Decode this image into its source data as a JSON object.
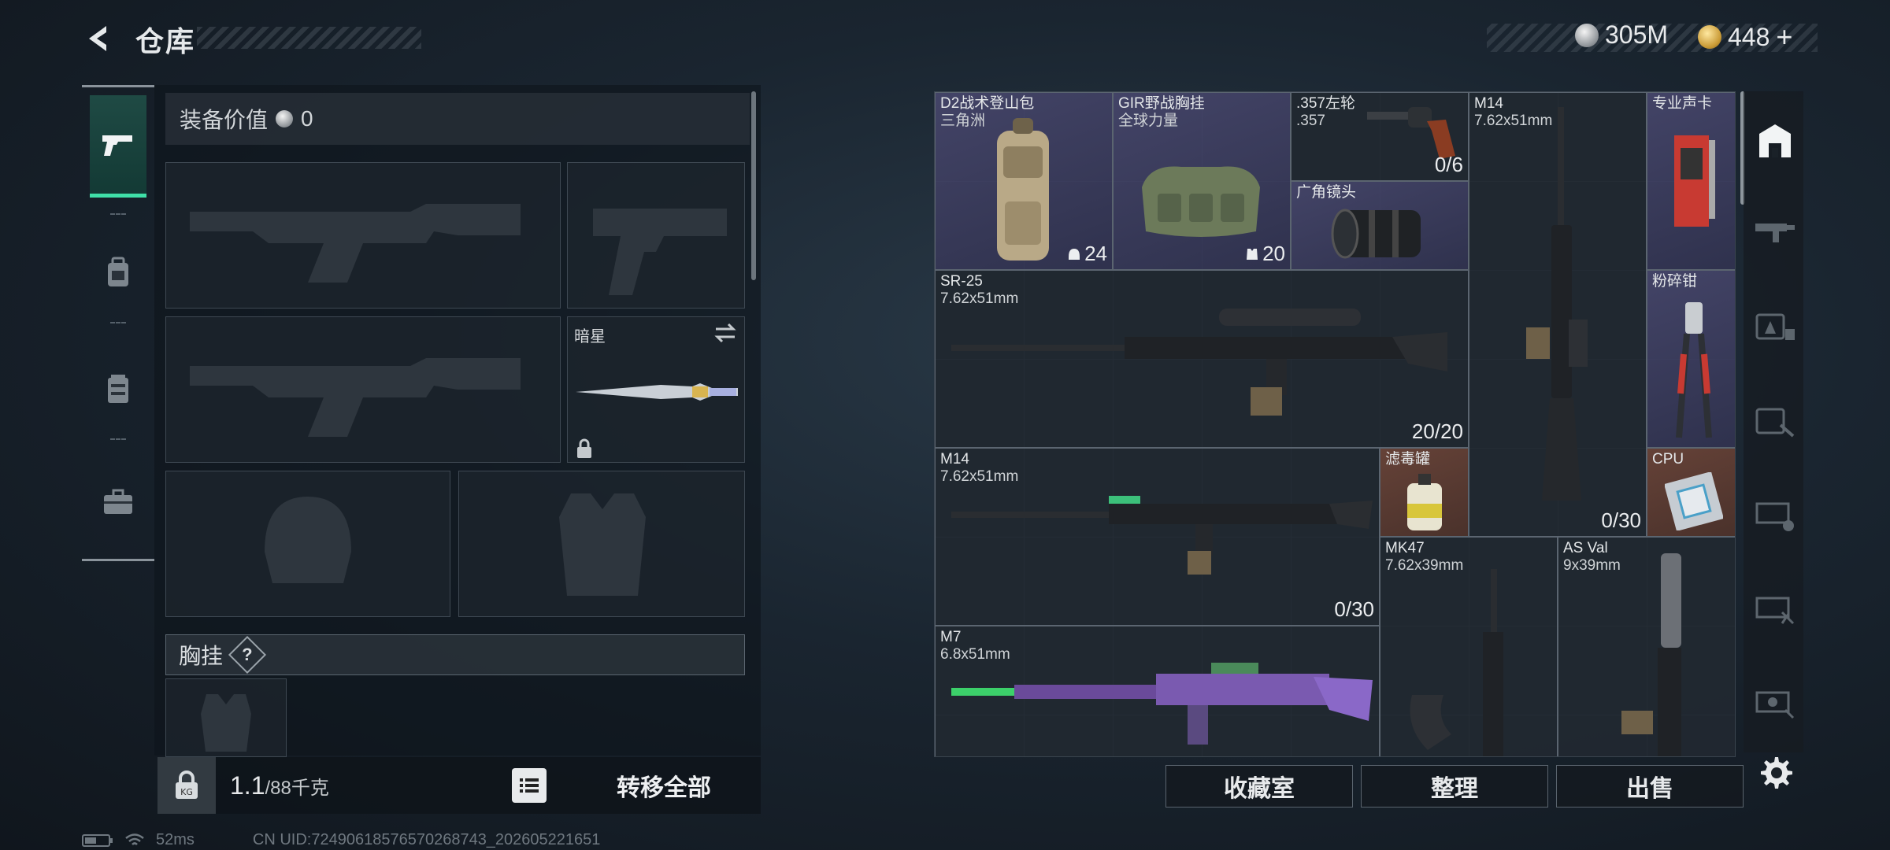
{
  "header": {
    "title": "仓库",
    "currency": [
      {
        "icon": "silver-coin-icon",
        "value": "305M"
      },
      {
        "icon": "gold-coin-icon",
        "value": "448"
      }
    ],
    "add_label": "+"
  },
  "loadout": {
    "equip_value_label": "装备价值",
    "equip_value": "0",
    "melee_name": "暗星",
    "chest_label": "胸挂",
    "chest_help": "?"
  },
  "footer_left": {
    "weight_current": "1.1",
    "weight_max": "/88千克",
    "transfer_all": "转移全部"
  },
  "status": {
    "ping": "52ms",
    "uid": "CN UID:72490618576570268743_202605221651"
  },
  "storage_items": [
    {
      "name": "D2战术登山包",
      "sub": "三角洲",
      "count": "24",
      "count_icon": "helmet-icon"
    },
    {
      "name": "GIR野战胸挂",
      "sub": "全球力量",
      "count": "20",
      "count_icon": "vest-icon"
    },
    {
      "name": ".357左轮",
      "sub": ".357",
      "count": "0/6"
    },
    {
      "name": "M14",
      "sub": "7.62x51mm",
      "count": "0/30"
    },
    {
      "name": "专业声卡",
      "sub": ""
    },
    {
      "name": "广角镜头",
      "sub": ""
    },
    {
      "name": "SR-25",
      "sub": "7.62x51mm",
      "count": "20/20"
    },
    {
      "name": "粉碎钳",
      "sub": ""
    },
    {
      "name": "M14",
      "sub": "7.62x51mm",
      "count": "0/30"
    },
    {
      "name": "滤毒罐",
      "sub": ""
    },
    {
      "name": "CPU",
      "sub": ""
    },
    {
      "name": "MK47",
      "sub": "7.62x39mm"
    },
    {
      "name": "AS Val",
      "sub": "9x39mm"
    },
    {
      "name": "M7",
      "sub": "6.8x51mm"
    }
  ],
  "storage_buttons": {
    "collection": "收藏室",
    "organize": "整理",
    "sell": "出售"
  },
  "colors": {
    "accent": "#3fe0a8",
    "purple_rarity": "#4a4a70",
    "red_rarity": "#6e463a"
  }
}
